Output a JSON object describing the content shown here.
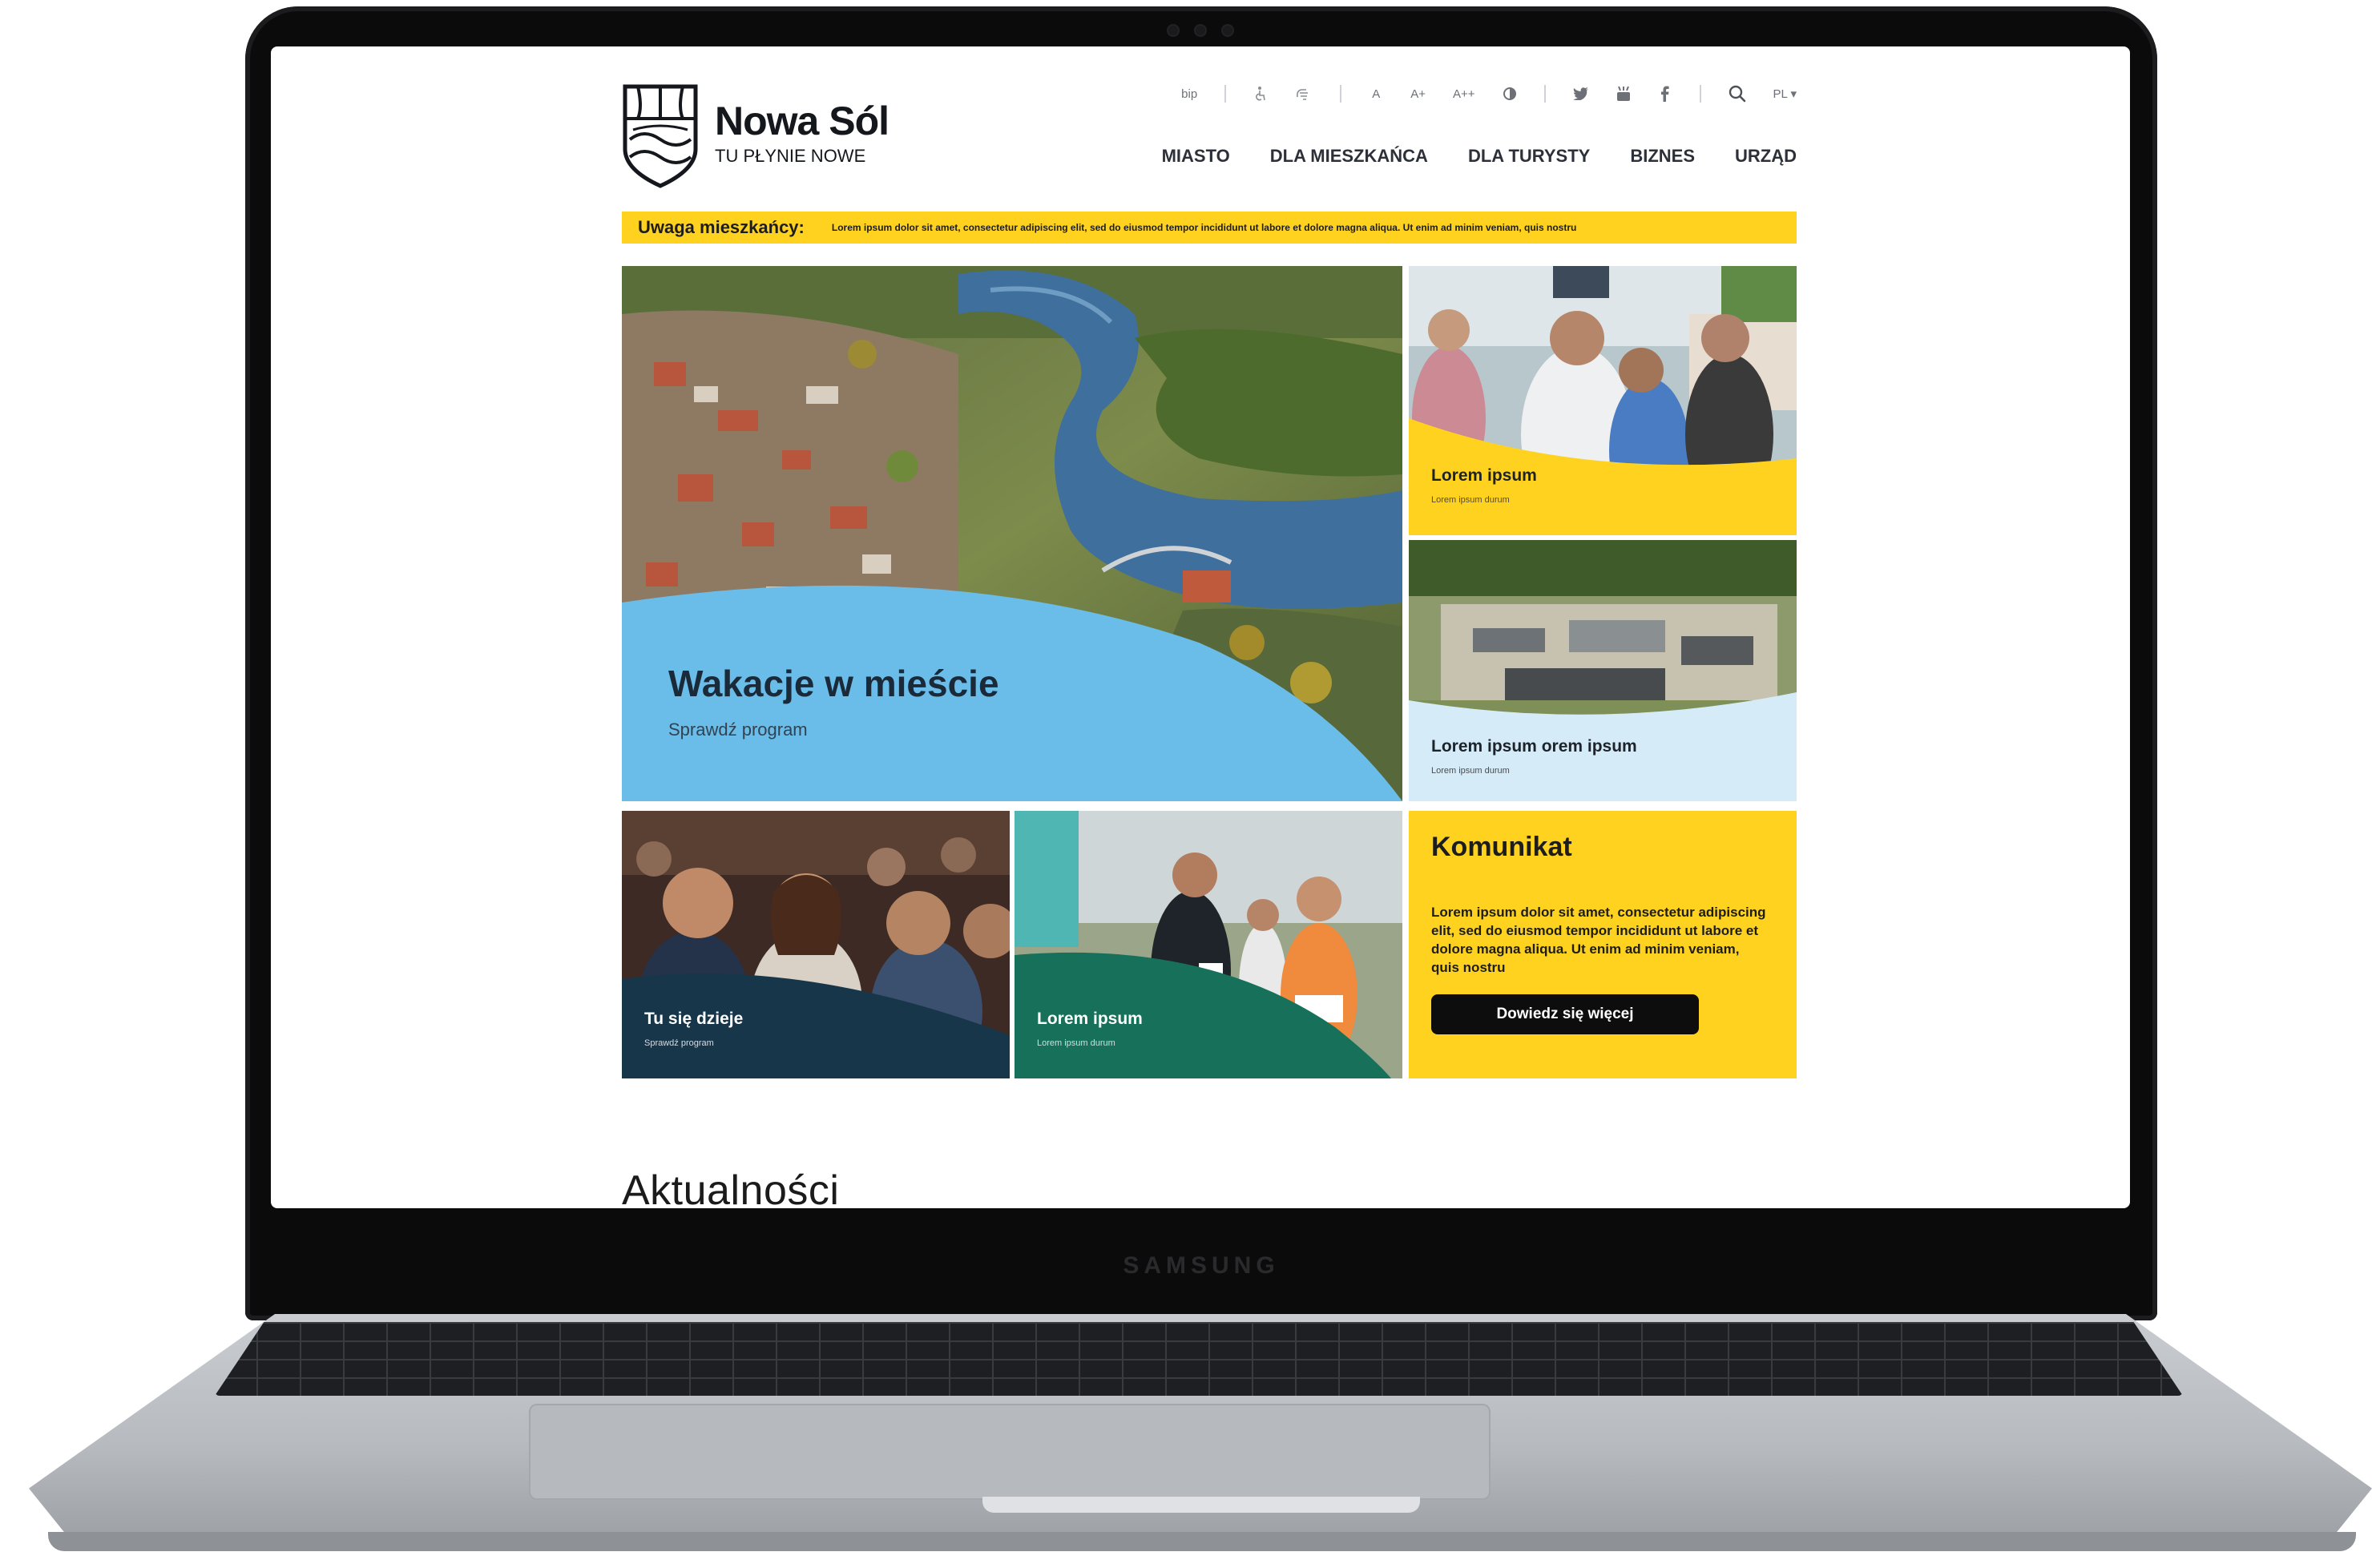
{
  "device": {
    "brand": "SAMSUNG"
  },
  "header": {
    "logo_name": "Nowa Sól",
    "logo_tagline": "TU PŁYNIE NOWE",
    "utility": {
      "bip": "bip",
      "font_a": "A",
      "font_a_plus": "A+",
      "font_a_plus_plus": "A++",
      "language": "PL ▾"
    },
    "nav": [
      "MIASTO",
      "DLA MIESZKAŃCA",
      "DLA TURYSTY",
      "BIZNES",
      "URZĄD"
    ]
  },
  "alert": {
    "title": "Uwaga mieszkańcy:",
    "text": "Lorem ipsum dolor sit amet, consectetur adipiscing elit, sed do eiusmod tempor incididunt ut labore et dolore magna aliqua. Ut enim ad minim veniam, quis nostru"
  },
  "tiles": {
    "hero": {
      "title": "Wakacje w mieście",
      "subtitle": "Sprawdź program"
    },
    "top_right_1": {
      "title": "Lorem ipsum",
      "subtitle": "Lorem ipsum durum"
    },
    "top_right_2": {
      "title": "Lorem ipsum orem ipsum",
      "subtitle": "Lorem ipsum durum"
    },
    "bottom_1": {
      "title": "Tu się dzieje",
      "subtitle": "Sprawdź program"
    },
    "bottom_2": {
      "title": "Lorem ipsum",
      "subtitle": "Lorem ipsum durum"
    },
    "komunikat": {
      "title": "Komunikat",
      "text": "Lorem ipsum dolor sit amet, consectetur adipiscing elit, sed do eiusmod tempor incididunt ut labore et dolore magna aliqua. Ut enim ad minim veniam, quis nostru",
      "button": "Dowiedz się więcej"
    }
  },
  "sections": {
    "news_heading": "Aktualności"
  },
  "colors": {
    "accent_yellow": "#ffd21f",
    "hero_blue": "#6bbde9",
    "light_blue": "#d6ebf8",
    "navy": "#183649",
    "green": "#16705a"
  },
  "icons": [
    "accessibility-icon",
    "sign-language-icon",
    "contrast-icon",
    "twitter-icon",
    "youtube-icon",
    "facebook-icon",
    "search-icon"
  ]
}
